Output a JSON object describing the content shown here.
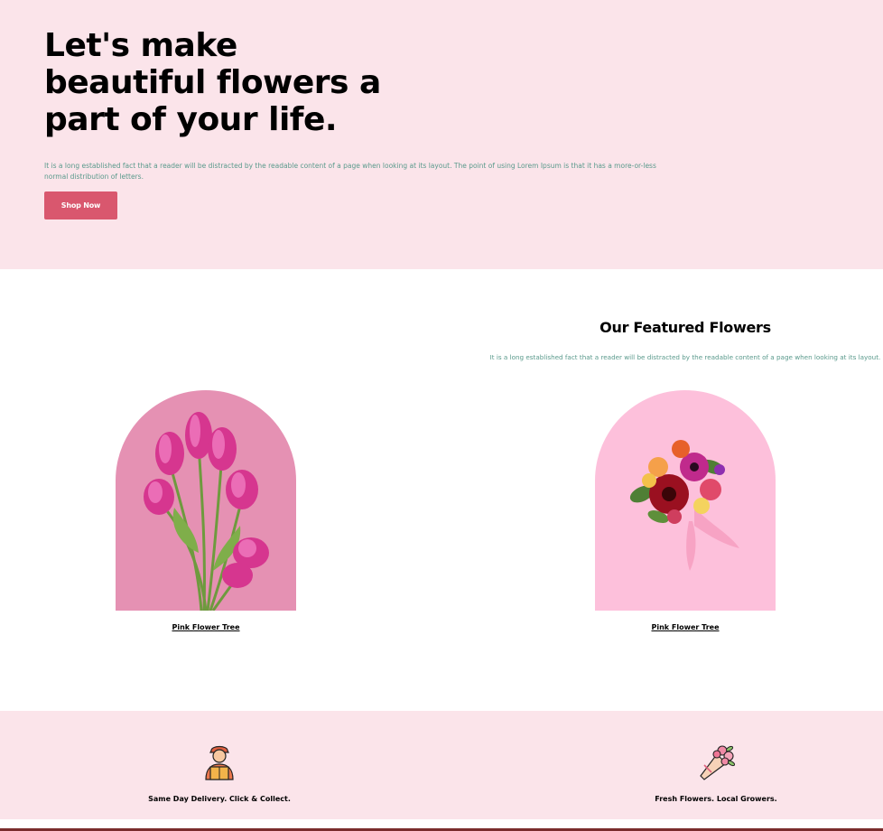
{
  "hero": {
    "title": "Let's make beautiful flowers a part of your life.",
    "text": "It is a long established fact that a reader will be distracted by the readable content of a page when looking at its layout. The point of using Lorem Ipsum is that it has a more-or-less normal distribution of letters.",
    "button_label": "Shop Now"
  },
  "featured": {
    "title": "Our Featured Flowers",
    "text": "It is a long established fact that a reader will be distracted by the readable content of a page when looking at its layout.",
    "items": [
      {
        "label": "Pink Flower Tree",
        "image": "pink-tulips-image"
      },
      {
        "label": "Pink Flower Tree",
        "image": "mixed-bouquet-image"
      }
    ]
  },
  "features": [
    {
      "label": "Same Day Delivery. Click & Collect.",
      "icon": "delivery-person-icon"
    },
    {
      "label": "Fresh Flowers. Local Growers.",
      "icon": "flower-bouquet-icon"
    }
  ],
  "colors": {
    "hero_bg": "#fbe4ea",
    "accent_button": "#d9576e",
    "body_text": "#5a9a8c",
    "arch_one_bg": "#e591b3",
    "arch_two_bg": "#fdc0db"
  }
}
